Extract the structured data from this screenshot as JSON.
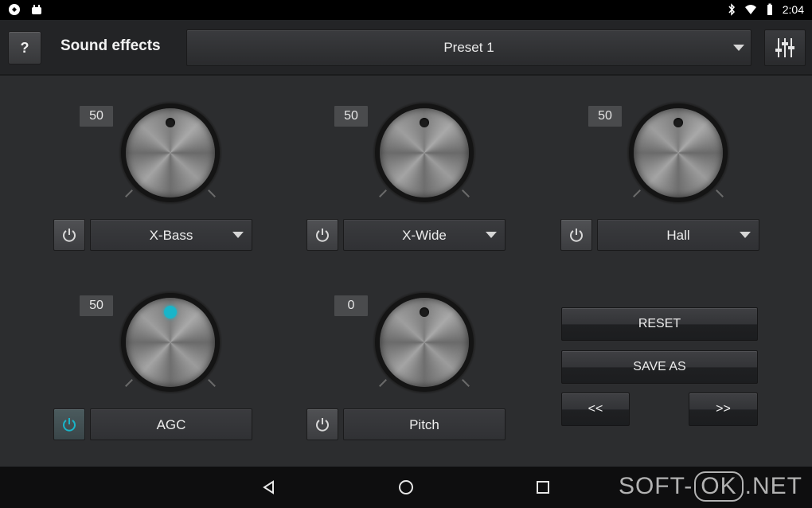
{
  "status_bar": {
    "time": "2:04",
    "icons": [
      "app-icon",
      "android-icon",
      "bluetooth-icon",
      "wifi-icon",
      "battery-icon"
    ]
  },
  "toolbar": {
    "help_label": "?",
    "title": "Sound effects",
    "preset": "Preset 1",
    "equalizer_icon": "equalizer-sliders-icon"
  },
  "effects": [
    {
      "value": "50",
      "label": "X-Bass",
      "enabled": false,
      "has_dropdown": true
    },
    {
      "value": "50",
      "label": "X-Wide",
      "enabled": false,
      "has_dropdown": true
    },
    {
      "value": "50",
      "label": "Hall",
      "enabled": false,
      "has_dropdown": true
    },
    {
      "value": "50",
      "label": "AGC",
      "enabled": true,
      "has_dropdown": false
    },
    {
      "value": "0",
      "label": "Pitch",
      "enabled": false,
      "has_dropdown": false
    }
  ],
  "actions": {
    "reset": "RESET",
    "save_as": "SAVE AS",
    "prev": "<<",
    "next": ">>"
  },
  "colors": {
    "accent": "#19b5c9",
    "background": "#2c2d2f"
  },
  "navbar": {
    "icons": [
      "back-icon",
      "home-icon",
      "recents-icon"
    ]
  },
  "watermark": {
    "left": "SOFT-",
    "box": "OK",
    "right": ".NET"
  }
}
